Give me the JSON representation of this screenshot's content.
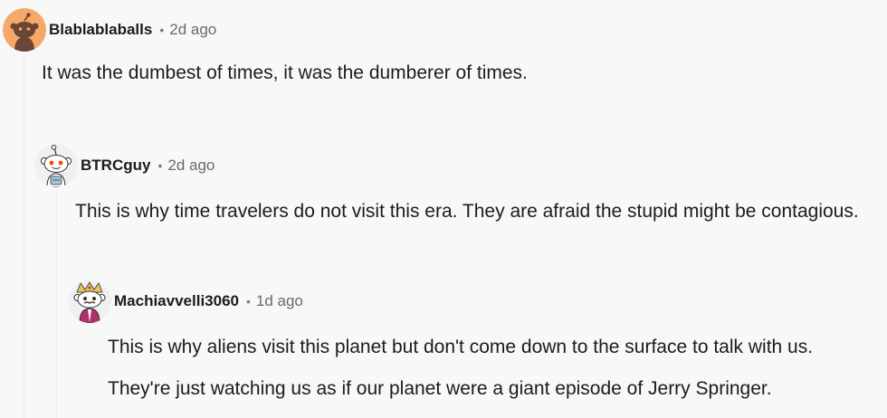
{
  "comments": [
    {
      "avatar_icon": "snoo-avatar-orange-icon",
      "username": "Blablablaballs",
      "separator": "•",
      "timestamp": "2d ago",
      "body": [
        "It was the dumbest of times, it was the dumberer of times."
      ]
    },
    {
      "avatar_icon": "snoo-avatar-default-icon",
      "username": "BTRCguy",
      "separator": "•",
      "timestamp": "2d ago",
      "body": [
        "This is why time travelers do not visit this era. They are afraid the stupid might be contagious."
      ]
    },
    {
      "avatar_icon": "snoo-avatar-costume-icon",
      "username": "Machiavvelli3060",
      "separator": "•",
      "timestamp": "1d ago",
      "body": [
        "This is why aliens visit this planet but don't come down to the surface to talk with us.",
        "They're just watching us as if our planet were a giant episode of Jerry Springer."
      ]
    }
  ],
  "colors": {
    "background": "#f8f8f8",
    "text": "#1c1c1c",
    "meta": "#6a6a6a",
    "avatar_orange": "#f4a460"
  }
}
